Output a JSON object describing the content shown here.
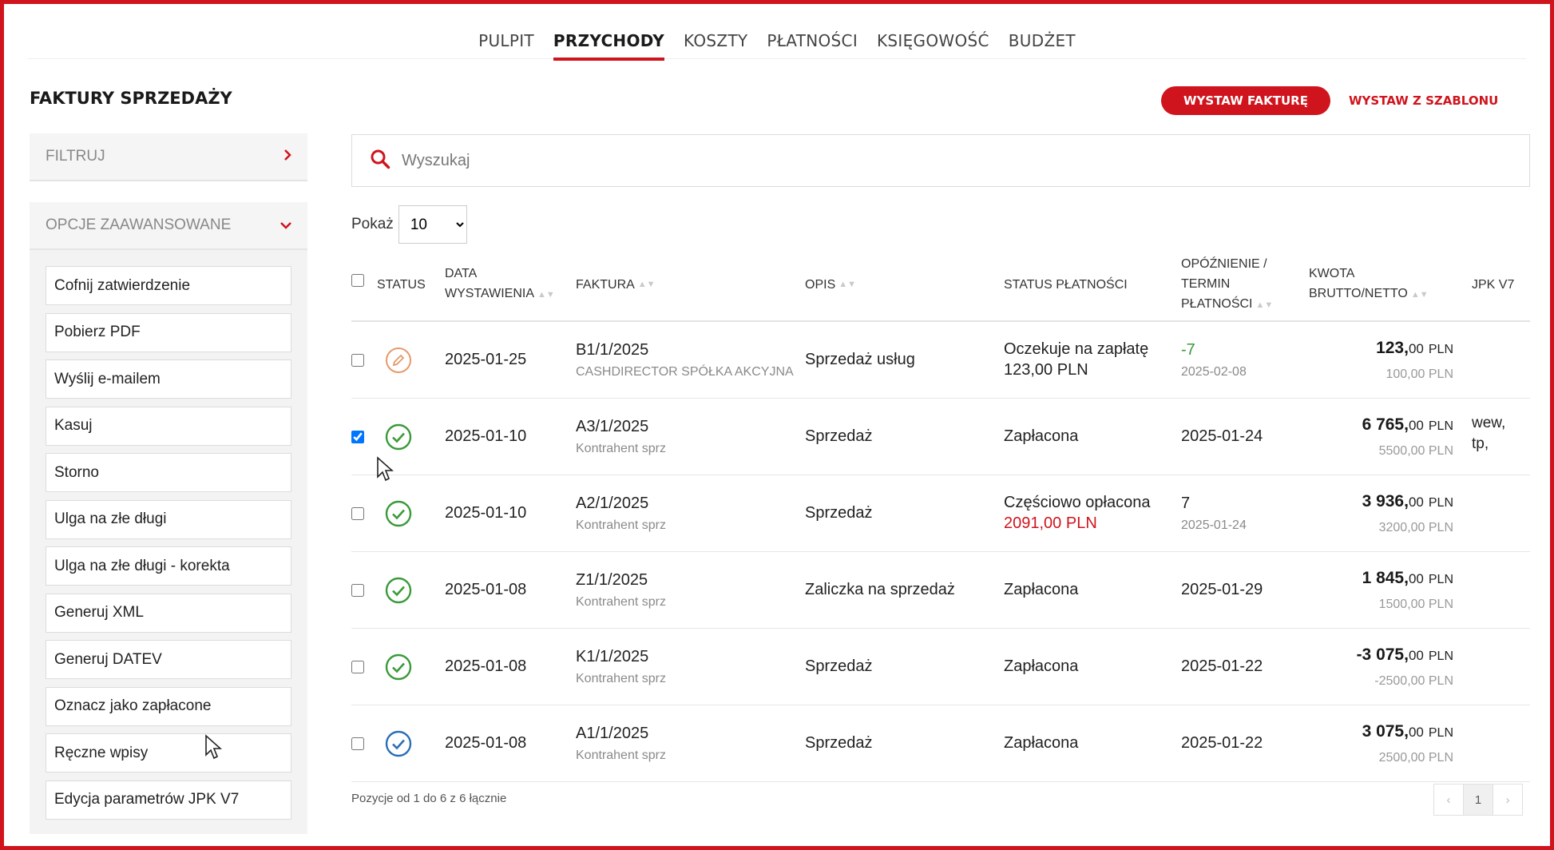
{
  "nav": {
    "items": [
      {
        "label": "PULPIT"
      },
      {
        "label": "PRZYCHODY"
      },
      {
        "label": "KOSZTY"
      },
      {
        "label": "PŁATNOŚCI"
      },
      {
        "label": "KSIĘGOWOŚĆ"
      },
      {
        "label": "BUDŻET"
      }
    ],
    "active": "PRZYCHODY"
  },
  "page": {
    "title": "FAKTURY SPRZEDAŻY",
    "primary_button": "WYSTAW FAKTURĘ",
    "secondary_button": "WYSTAW Z SZABLONU"
  },
  "sidebar": {
    "filter_label": "FILTRUJ",
    "advanced_label": "OPCJE ZAAWANSOWANE",
    "actions": [
      "Cofnij zatwierdzenie",
      "Pobierz PDF",
      "Wyślij e-mailem",
      "Kasuj",
      "Storno",
      "Ulga na złe długi",
      "Ulga na złe długi - korekta",
      "Generuj XML",
      "Generuj DATEV",
      "Oznacz jako zapłacone",
      "Ręczne wpisy",
      "Edycja parametrów JPK V7"
    ]
  },
  "search": {
    "placeholder": "Wyszukaj",
    "value": ""
  },
  "show": {
    "label": "Pokaż",
    "selected": "10"
  },
  "table": {
    "headers": {
      "status": "STATUS",
      "data_line1": "DATA",
      "data_line2": "WYSTAWIENIA",
      "faktura": "FAKTURA",
      "opis": "OPIS",
      "status_platnosci": "STATUS PŁATNOŚCI",
      "termin_line1": "OPÓŹNIENIE /",
      "termin_line2": "TERMIN",
      "termin_line3": "PŁATNOŚCI",
      "kwota_line1": "KWOTA",
      "kwota_line2": "BRUTTO/NETTO",
      "jpk": "JPK V7"
    },
    "rows": [
      {
        "checked": false,
        "status": "draft",
        "date": "2025-01-25",
        "invoice": "B1/1/2025",
        "client": "CASHDIRECTOR SPÓŁKA AKCYJNA",
        "desc": "Sprzedaż usług",
        "pay_status": "Oczekuje na zapłatę",
        "pay_sub": "123,00 PLN",
        "pay_sub_color": "#222222",
        "delay": "-7",
        "delay_color": "#3a9a3a",
        "due": "2025-02-08",
        "gross_int": "123,",
        "gross_dec": "00",
        "currency": "PLN",
        "net": "100,00 PLN",
        "jpk": ""
      },
      {
        "checked": true,
        "status": "paid",
        "date": "2025-01-10",
        "invoice": "A3/1/2025",
        "client": "Kontrahent sprz",
        "desc": "Sprzedaż",
        "pay_status": "Zapłacona",
        "pay_sub": "",
        "pay_sub_color": "#222222",
        "delay": "2025-01-24",
        "delay_color": "#222222",
        "due": "",
        "gross_int": "6 765,",
        "gross_dec": "00",
        "currency": "PLN",
        "net": "5500,00 PLN",
        "jpk": "wew,\ntp,"
      },
      {
        "checked": false,
        "status": "paid",
        "date": "2025-01-10",
        "invoice": "A2/1/2025",
        "client": "Kontrahent sprz",
        "desc": "Sprzedaż",
        "pay_status": "Częściowo opłacona",
        "pay_sub": "2091,00 PLN",
        "pay_sub_color": "#d0141d",
        "delay": "7",
        "delay_color": "#222222",
        "due": "2025-01-24",
        "gross_int": "3 936,",
        "gross_dec": "00",
        "currency": "PLN",
        "net": "3200,00 PLN",
        "jpk": ""
      },
      {
        "checked": false,
        "status": "paid",
        "date": "2025-01-08",
        "invoice": "Z1/1/2025",
        "client": "Kontrahent sprz",
        "desc": "Zaliczka na sprzedaż",
        "pay_status": "Zapłacona",
        "pay_sub": "",
        "pay_sub_color": "#222222",
        "delay": "2025-01-29",
        "delay_color": "#222222",
        "due": "",
        "gross_int": "1 845,",
        "gross_dec": "00",
        "currency": "PLN",
        "net": "1500,00 PLN",
        "jpk": ""
      },
      {
        "checked": false,
        "status": "paid",
        "date": "2025-01-08",
        "invoice": "K1/1/2025",
        "client": "Kontrahent sprz",
        "desc": "Sprzedaż",
        "pay_status": "Zapłacona",
        "pay_sub": "",
        "pay_sub_color": "#222222",
        "delay": "2025-01-22",
        "delay_color": "#222222",
        "due": "",
        "gross_int": "-3 075,",
        "gross_dec": "00",
        "currency": "PLN",
        "net": "-2500,00 PLN",
        "jpk": ""
      },
      {
        "checked": false,
        "status": "paid-blue",
        "date": "2025-01-08",
        "invoice": "A1/1/2025",
        "client": "Kontrahent sprz",
        "desc": "Sprzedaż",
        "pay_status": "Zapłacona",
        "pay_sub": "",
        "pay_sub_color": "#222222",
        "delay": "2025-01-22",
        "delay_color": "#222222",
        "due": "",
        "gross_int": "3 075,",
        "gross_dec": "00",
        "currency": "PLN",
        "net": "2500,00 PLN",
        "jpk": ""
      }
    ]
  },
  "footer": {
    "info": "Pozycje od 1 do 6 z 6 łącznie",
    "current_page": "1"
  },
  "icons": {
    "draft": "pencil-circle-icon",
    "paid": "check-circle-green-icon",
    "paid-blue": "check-circle-blue-icon",
    "search": "search-icon",
    "filter_chevron": "chevron-right-icon",
    "advanced_chevron": "chevron-down-icon"
  },
  "colors": {
    "accent": "#d0141d",
    "paid_green": "#3a9a3a",
    "paid_blue": "#2a6fb5",
    "draft_orange": "#e59a6a"
  }
}
